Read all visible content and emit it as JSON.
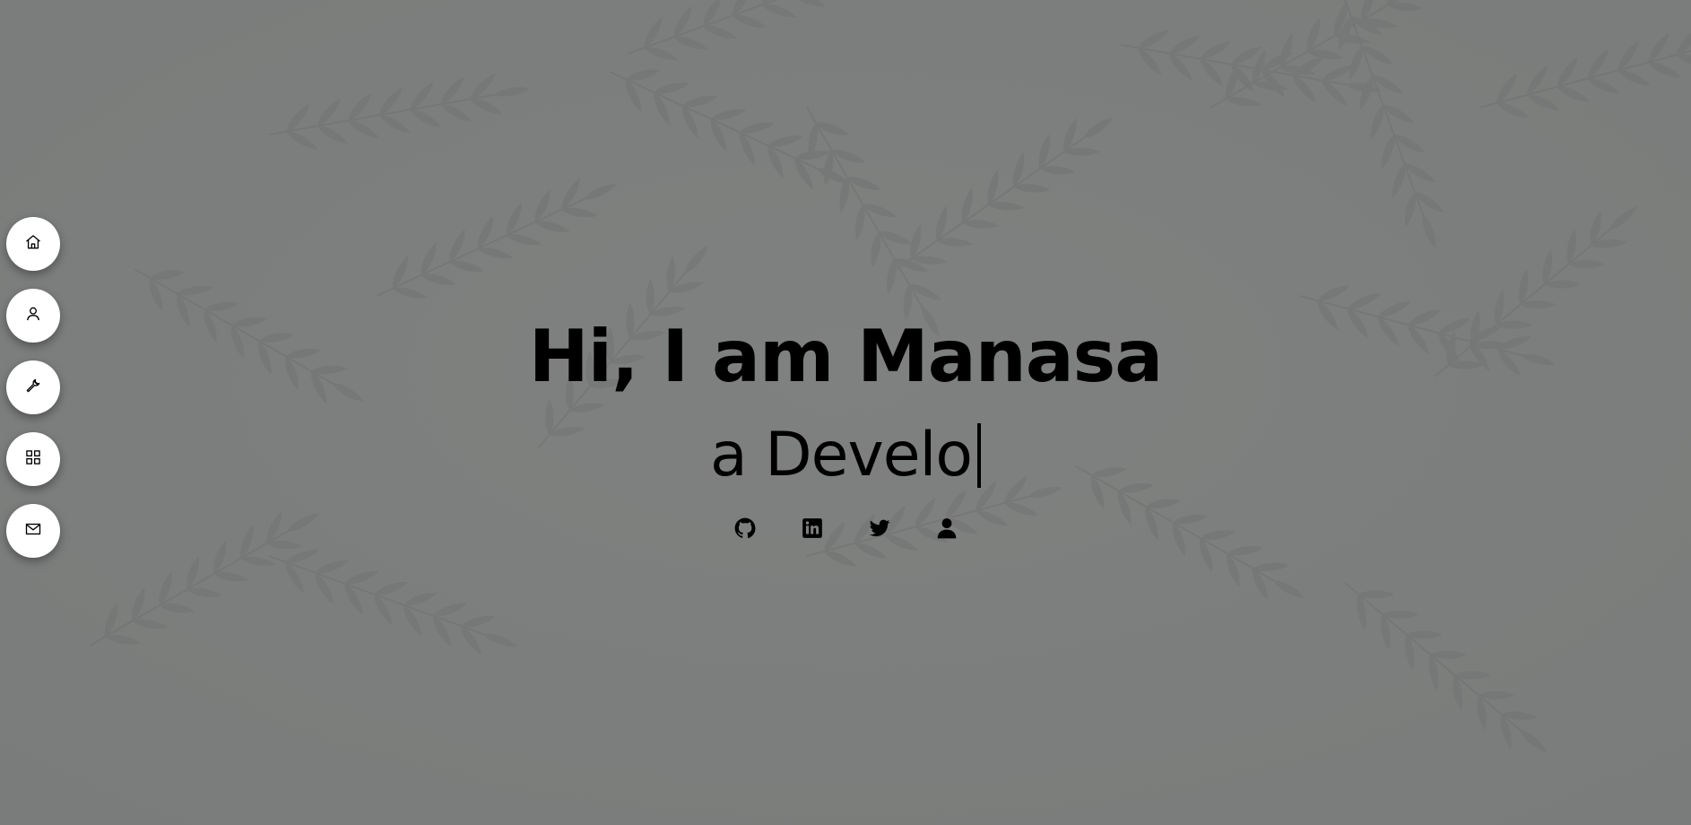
{
  "hero": {
    "title": "Hi, I am Manasa",
    "typing_text": "a Develo"
  },
  "nav": {
    "items": [
      {
        "name": "home",
        "icon": "home-icon"
      },
      {
        "name": "about",
        "icon": "user-icon"
      },
      {
        "name": "skills",
        "icon": "wrench-icon"
      },
      {
        "name": "projects",
        "icon": "grid-icon"
      },
      {
        "name": "contact",
        "icon": "mail-icon"
      }
    ]
  },
  "socials": [
    {
      "icon": "github-icon"
    },
    {
      "icon": "linkedin-icon"
    },
    {
      "icon": "twitter-icon"
    },
    {
      "icon": "person-icon"
    }
  ],
  "colors": {
    "background": "#7d7f7e",
    "text": "#000000",
    "nav_button": "#ffffff"
  }
}
